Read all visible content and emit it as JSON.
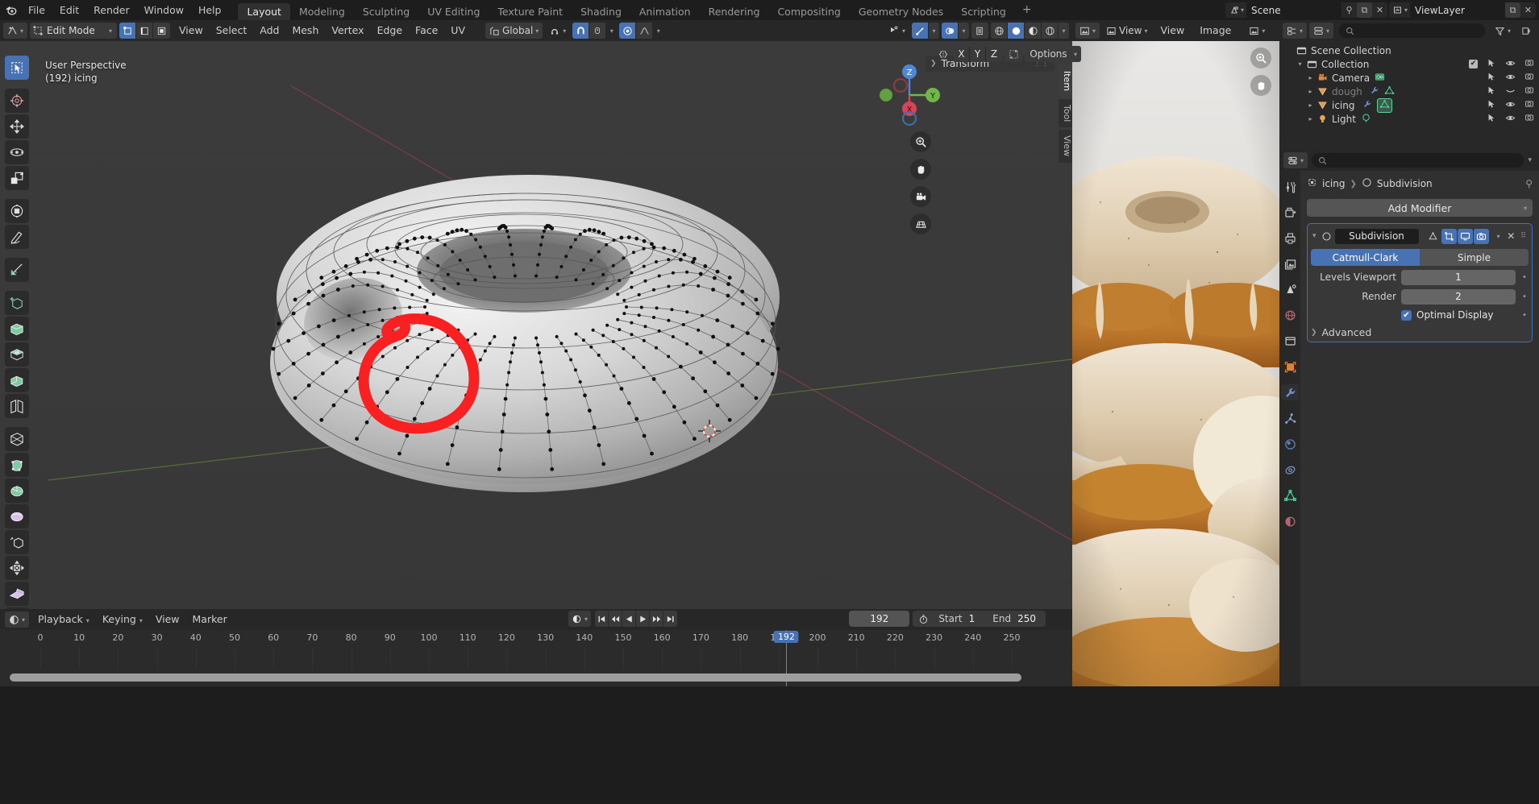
{
  "app": {
    "logo_icon": "blender-logo",
    "menus": [
      "File",
      "Edit",
      "Render",
      "Window",
      "Help"
    ],
    "workspaces": [
      "Layout",
      "Modeling",
      "Sculpting",
      "UV Editing",
      "Texture Paint",
      "Shading",
      "Animation",
      "Rendering",
      "Compositing",
      "Geometry Nodes",
      "Scripting"
    ],
    "active_workspace": "Layout",
    "add_workspace_label": "+",
    "scene_name": "Scene",
    "viewlayer_name": "ViewLayer"
  },
  "viewport_header": {
    "editor_type_icon": "editor-type-3dview-icon",
    "mode": "Edit Mode",
    "select_modes": [
      "vertex-select-icon",
      "edge-select-icon",
      "face-select-icon"
    ],
    "active_select_mode": 0,
    "menus": [
      "View",
      "Select",
      "Add",
      "Mesh",
      "Vertex",
      "Edge",
      "Face",
      "UV"
    ],
    "transform_orientation": "Global",
    "snap_icon": "magnet-icon",
    "proportional_icon": "proportional-edit-icon",
    "falloff_icon": "falloff-curve-icon",
    "xyz_buttons": [
      "X",
      "Y",
      "Z"
    ],
    "mirror_icon": "mirror-icon",
    "options_label": "Options",
    "visibility_icon": "visibility-selectability-icon",
    "gizmo_icon": "gizmo-icon",
    "overlays_icon": "overlays-icon",
    "xray_icon": "toggle-xray-icon",
    "shading_modes": [
      "wireframe-shading-icon",
      "solid-shading-icon",
      "material-preview-icon",
      "rendered-shading-icon"
    ],
    "active_shading": 1
  },
  "viewport": {
    "perspective_label": "User Perspective",
    "object_info": "(192) icing",
    "gizmo_axes": [
      "X",
      "Y",
      "Z"
    ],
    "nav_buttons": [
      "zoom-icon",
      "pan-hand-icon",
      "camera-view-icon",
      "ortho-persp-icon"
    ],
    "side_tabs": [
      "Item",
      "Tool",
      "View"
    ],
    "active_side_tab": "Item",
    "transform_panel_label": "Transform",
    "annotation_color": "#f82020",
    "tools": [
      {
        "name": "tweak-select-tool",
        "active": true
      },
      {
        "name": "cursor-tool",
        "active": false
      },
      {
        "name": "move-tool",
        "active": false
      },
      {
        "name": "rotate-tool",
        "active": false
      },
      {
        "name": "scale-tool",
        "active": false
      },
      {
        "name": "transform-tool",
        "active": false
      },
      {
        "name": "annotate-tool",
        "active": false
      },
      {
        "name": "measure-tool",
        "active": false
      },
      {
        "name": "add-cube-tool",
        "active": false
      },
      {
        "name": "extrude-region-tool",
        "active": false
      },
      {
        "name": "inset-faces-tool",
        "active": false
      },
      {
        "name": "bevel-tool",
        "active": false
      },
      {
        "name": "loop-cut-tool",
        "active": false
      },
      {
        "name": "knife-tool",
        "active": false
      },
      {
        "name": "poly-build-tool",
        "active": false
      },
      {
        "name": "spin-tool",
        "active": false
      },
      {
        "name": "smooth-tool",
        "active": false
      },
      {
        "name": "edge-slide-tool",
        "active": false
      },
      {
        "name": "shrink-fatten-tool",
        "active": false
      },
      {
        "name": "shear-tool",
        "active": false
      },
      {
        "name": "rip-region-tool",
        "active": false
      }
    ]
  },
  "image_editor": {
    "editor_type_icon": "editor-type-image-icon",
    "menus": [
      "View",
      "Image"
    ],
    "view_menu_icon": "image-display-icon",
    "browse_icon": "browse-image-icon",
    "zoom_icon": "zoom-icon",
    "pan_icon": "pan-hand-icon",
    "reference_description": "stacked glazed donuts reference photo"
  },
  "outliner": {
    "display_mode_icon": "outliner-display-mode-icon",
    "filter_icon": "filter-icon",
    "search_placeholder": "",
    "root": "Scene Collection",
    "items": [
      {
        "label": "Collection",
        "icon": "collection-icon",
        "indent": 1,
        "expanded": true,
        "checkbox": true,
        "dim": false,
        "icons": [
          "cursor-arrow-icon",
          "eye-icon",
          "camera-icon"
        ]
      },
      {
        "label": "Camera",
        "icon": "camera-object-icon",
        "indent": 2,
        "expanded": false,
        "checkbox": false,
        "dim": false,
        "data_icon": "camera-data-icon",
        "icons": [
          "cursor-arrow-icon",
          "eye-icon",
          "camera-icon"
        ]
      },
      {
        "label": "dough",
        "icon": "mesh-object-icon",
        "indent": 2,
        "expanded": false,
        "checkbox": false,
        "dim": true,
        "data_icon": "mesh-data-icon",
        "modifier_icon": "wrench-icon",
        "icons": [
          "cursor-arrow-icon",
          "eye-closed-icon",
          "camera-icon"
        ]
      },
      {
        "label": "icing",
        "icon": "mesh-object-icon",
        "indent": 2,
        "expanded": false,
        "checkbox": false,
        "dim": false,
        "data_icon": "mesh-data-icon",
        "modifier_icon": "wrench-icon",
        "icons": [
          "cursor-arrow-icon",
          "eye-icon",
          "camera-icon"
        ]
      },
      {
        "label": "Light",
        "icon": "light-object-icon",
        "indent": 2,
        "expanded": false,
        "checkbox": false,
        "dim": false,
        "data_icon": "light-data-icon",
        "icons": [
          "cursor-arrow-icon",
          "eye-icon",
          "camera-icon"
        ]
      }
    ]
  },
  "properties": {
    "editor_type_icon": "editor-type-properties-icon",
    "search_placeholder": "",
    "breadcrumb_object": "icing",
    "breadcrumb_modifier": "Subdivision",
    "breadcrumb_object_icon": "object-data-icon",
    "breadcrumb_modifier_icon": "subdivision-icon",
    "pin_icon": "pin-icon",
    "tabs": [
      {
        "name": "tool-tab",
        "icon": "tool-icon",
        "active": false
      },
      {
        "name": "render-tab",
        "icon": "render-camera-icon",
        "active": false
      },
      {
        "name": "output-tab",
        "icon": "printer-icon",
        "active": false
      },
      {
        "name": "viewlayer-tab",
        "icon": "images-icon",
        "active": false
      },
      {
        "name": "scene-tab",
        "icon": "scene-cone-icon",
        "active": false
      },
      {
        "name": "world-tab",
        "icon": "world-globe-icon",
        "active": false
      },
      {
        "name": "collection-tab",
        "icon": "collection-box-icon",
        "active": false
      },
      {
        "name": "object-tab",
        "icon": "object-square-icon",
        "active": false
      },
      {
        "name": "modifier-tab",
        "icon": "wrench-icon",
        "active": true
      },
      {
        "name": "particles-tab",
        "icon": "particles-icon",
        "active": false
      },
      {
        "name": "physics-tab",
        "icon": "physics-orbit-icon",
        "active": false
      },
      {
        "name": "constraints-tab",
        "icon": "constraint-icon",
        "active": false
      },
      {
        "name": "data-tab",
        "icon": "mesh-data-triangle-icon",
        "active": false
      },
      {
        "name": "material-tab",
        "icon": "material-sphere-icon",
        "active": false
      }
    ],
    "add_modifier_label": "Add Modifier",
    "modifier": {
      "name": "Subdivision",
      "icon": "subdivision-icon",
      "expand_icon": "chevron-down-icon",
      "display_toggles": [
        {
          "name": "on-cage-toggle",
          "icon": "edit-mode-cage-icon",
          "on": false
        },
        {
          "name": "edit-mode-display-toggle",
          "icon": "edit-mode-icon",
          "on": true
        },
        {
          "name": "realtime-display-toggle",
          "icon": "monitor-icon",
          "on": true
        },
        {
          "name": "render-display-toggle",
          "icon": "camera-icon",
          "on": true
        }
      ],
      "dropdown_icon": "chevron-down-icon",
      "close_icon": "x-icon",
      "grip_icon": "grip-dots-icon",
      "algorithms": [
        "Catmull-Clark",
        "Simple"
      ],
      "active_algorithm": "Catmull-Clark",
      "rows": [
        {
          "label": "Levels Viewport",
          "value": "1"
        },
        {
          "label": "Render",
          "value": "2"
        }
      ],
      "optimal_display_label": "Optimal Display",
      "optimal_display_checked": true,
      "advanced_label": "Advanced",
      "advanced_expanded": false
    },
    "accent_color": "#4772b3"
  },
  "timeline": {
    "editor_type_icon": "editor-type-timeline-icon",
    "menus": [
      "Playback",
      "Keying",
      "View",
      "Marker"
    ],
    "autokey_icon": "record-dot-icon",
    "transport_buttons": [
      "jump-to-start-icon",
      "jump-to-keyframe-prev-icon",
      "play-reverse-icon",
      "play-icon",
      "jump-to-keyframe-next-icon",
      "jump-to-end-icon"
    ],
    "current_frame": "192",
    "current_frame_icon": "stopwatch-icon",
    "start_label": "Start",
    "start_value": "1",
    "end_label": "End",
    "end_value": "250",
    "ticks": [
      "0",
      "10",
      "20",
      "30",
      "40",
      "50",
      "60",
      "70",
      "80",
      "90",
      "100",
      "110",
      "120",
      "130",
      "140",
      "150",
      "160",
      "170",
      "180",
      "190",
      "200",
      "210",
      "220",
      "230",
      "240",
      "250"
    ],
    "playhead_frame": 192,
    "playhead_color": "#4772b3"
  }
}
